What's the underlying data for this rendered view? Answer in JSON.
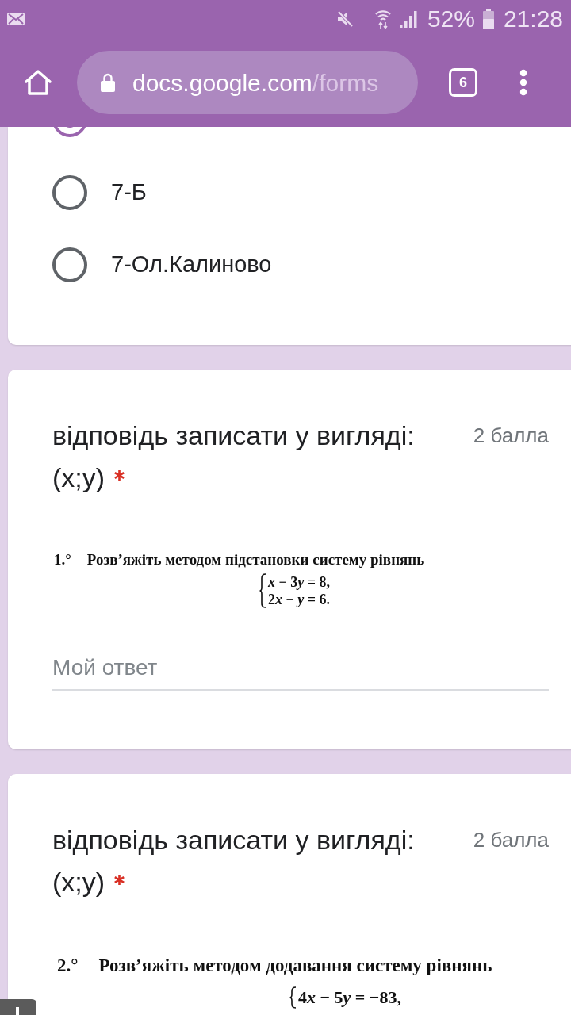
{
  "status_bar": {
    "battery": "52%",
    "time": "21:28"
  },
  "browser_bar": {
    "url_host": "docs.google.com",
    "url_path": "/forms",
    "tab_count": "6"
  },
  "choice_question": {
    "options": [
      {
        "selected": true
      },
      {
        "label": "7-Б",
        "selected": false
      },
      {
        "label": "7-Ол.Калиново",
        "selected": false
      }
    ]
  },
  "questions": [
    {
      "title": "відповідь записати у вигляді: (x;y)",
      "points": "2 балла",
      "required": true,
      "image": {
        "number": "1.°",
        "instruction": "Розв’яжіть методом підстановки систему рівнянь",
        "equations": [
          "x − 3y = 8,",
          "2x − y = 6."
        ]
      },
      "answer": {
        "placeholder": "Мой ответ"
      }
    },
    {
      "title": "відповідь записати у вигляді: (x;y)",
      "points": "2 балла",
      "required": true,
      "image": {
        "number": "2.°",
        "instruction": "Розв’яжіть методом додавання систему рівнянь",
        "equations": [
          "4x − 5y = −83,"
        ]
      }
    }
  ]
}
